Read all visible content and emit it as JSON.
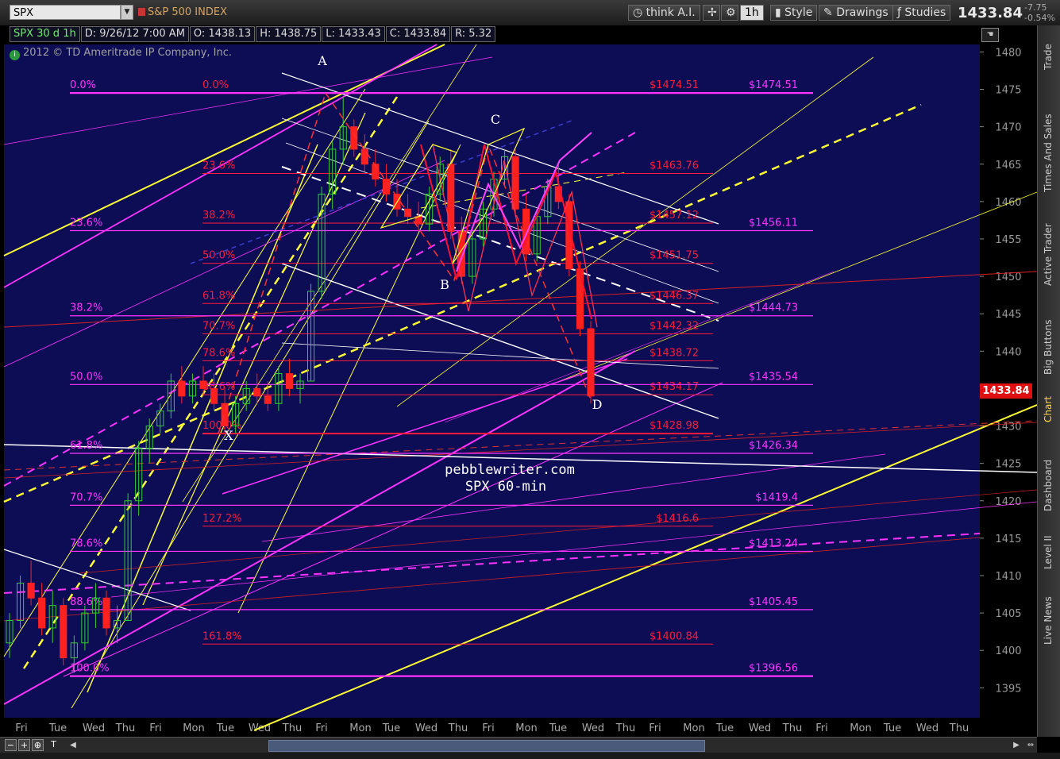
{
  "toolbar": {
    "symbol": "SPX",
    "symbol_name": "S&P 500 INDEX",
    "think_ai": "think A.I.",
    "timeframe": "1h",
    "style": "Style",
    "drawings": "Drawings",
    "studies": "Studies",
    "last_price": "1433.84",
    "change": "-7.75",
    "change_pct": "-0.54%"
  },
  "infobar": {
    "symbol_tf": "SPX 30 d 1h",
    "date": "D: 9/26/12 7:00 AM",
    "open": "O: 1438.13",
    "high": "H: 1438.75",
    "low": "L: 1433.43",
    "close": "C: 1433.84",
    "range": "R: 5.32"
  },
  "copyright": "2012 © TD Ameritrade IP Company, Inc.",
  "right_tabs": [
    "Trade",
    "Times And Sales",
    "Active Trader",
    "Big Buttons",
    "Chart",
    "Dashboard",
    "Level II",
    "Live News"
  ],
  "active_tab": "Chart",
  "price_flag": "1433.84",
  "colors": {
    "background": "#0d0d56",
    "candle_up": "#33cc33",
    "candle_down": "#ff2020",
    "fib_red": "#ff1a3a",
    "fib_magenta": "#ff33ff",
    "yellow": "#ffff33",
    "white": "#ffffff"
  },
  "chart_data": {
    "type": "candlestick",
    "title": "",
    "watermark": [
      "pebblewriter.com",
      "SPX 60-min"
    ],
    "ylim": [
      1391,
      1481
    ],
    "y_ticks": [
      1395,
      1400,
      1405,
      1410,
      1415,
      1420,
      1425,
      1430,
      1435,
      1440,
      1445,
      1450,
      1455,
      1460,
      1465,
      1470,
      1475,
      1480
    ],
    "x_ticks": [
      "Fri",
      "Tue",
      "Wed",
      "Thu",
      "Fri",
      "Mon",
      "Tue",
      "Wed",
      "Thu",
      "Fri",
      "Mon",
      "Tue",
      "Wed",
      "Thu",
      "Fri",
      "Mon",
      "Tue",
      "Wed",
      "Thu",
      "Fri",
      "Mon",
      "Tue",
      "Wed",
      "Thu"
    ],
    "pattern_points": [
      {
        "label": "X",
        "price": 1429.0
      },
      {
        "label": "A",
        "price": 1474.5
      },
      {
        "label": "B",
        "price": 1449.5
      },
      {
        "label": "C",
        "price": 1467.5
      },
      {
        "label": "D",
        "price": 1433.8
      }
    ],
    "fib_levels_red": [
      {
        "pct": "0.0%",
        "price": 1474.51
      },
      {
        "pct": "23.6%",
        "price": 1463.76
      },
      {
        "pct": "38.2%",
        "price": 1457.12
      },
      {
        "pct": "50.0%",
        "price": 1451.75
      },
      {
        "pct": "61.8%",
        "price": 1446.37
      },
      {
        "pct": "70.7%",
        "price": 1442.32
      },
      {
        "pct": "78.6%",
        "price": 1438.72
      },
      {
        "pct": "88.6%",
        "price": 1434.17
      },
      {
        "pct": "100.0%",
        "price": 1428.98
      },
      {
        "pct": "127.2%",
        "price": 1416.6
      },
      {
        "pct": "161.8%",
        "price": 1400.84
      }
    ],
    "fib_levels_magenta": [
      {
        "pct": "0.0%",
        "price": 1474.51
      },
      {
        "pct": "23.6%",
        "price": 1456.11
      },
      {
        "pct": "38.2%",
        "price": 1444.73
      },
      {
        "pct": "50.0%",
        "price": 1435.54
      },
      {
        "pct": "61.8%",
        "price": 1426.34
      },
      {
        "pct": "70.7%",
        "price": 1419.4
      },
      {
        "pct": "78.6%",
        "price": 1413.24
      },
      {
        "pct": "88.6%",
        "price": 1405.45
      },
      {
        "pct": "100.0%",
        "price": 1396.56
      }
    ],
    "price_labels_red": [
      "$1474.51",
      "$1463.76",
      "$1457.12",
      "$1451.75",
      "$1446.37",
      "$1442.32",
      "$1438.72",
      "$1434.17",
      "$1428.98",
      "$1416.6",
      "$1400.84"
    ],
    "price_labels_magenta": [
      "$1474.51",
      "$1456.11",
      "$1444.73",
      "$1435.54",
      "$1426.34",
      "$1419.4",
      "$1413.24",
      "$1405.45",
      "$1396.56"
    ],
    "candles": [
      {
        "o": 1401,
        "h": 1405,
        "l": 1399,
        "c": 1404
      },
      {
        "o": 1404,
        "h": 1410,
        "l": 1403,
        "c": 1409
      },
      {
        "o": 1409,
        "h": 1412,
        "l": 1406,
        "c": 1407
      },
      {
        "o": 1407,
        "h": 1409,
        "l": 1402,
        "c": 1403
      },
      {
        "o": 1403,
        "h": 1408,
        "l": 1401,
        "c": 1406
      },
      {
        "o": 1406,
        "h": 1407,
        "l": 1398,
        "c": 1399
      },
      {
        "o": 1399,
        "h": 1402,
        "l": 1397,
        "c": 1401
      },
      {
        "o": 1401,
        "h": 1406,
        "l": 1400,
        "c": 1405
      },
      {
        "o": 1405,
        "h": 1409,
        "l": 1403,
        "c": 1407
      },
      {
        "o": 1407,
        "h": 1408,
        "l": 1402,
        "c": 1403
      },
      {
        "o": 1403,
        "h": 1406,
        "l": 1401,
        "c": 1404
      },
      {
        "o": 1404,
        "h": 1421,
        "l": 1404,
        "c": 1420
      },
      {
        "o": 1420,
        "h": 1428,
        "l": 1418,
        "c": 1427
      },
      {
        "o": 1427,
        "h": 1431,
        "l": 1425,
        "c": 1430
      },
      {
        "o": 1430,
        "h": 1433,
        "l": 1429,
        "c": 1432
      },
      {
        "o": 1432,
        "h": 1437,
        "l": 1431,
        "c": 1436
      },
      {
        "o": 1436,
        "h": 1438,
        "l": 1433,
        "c": 1434
      },
      {
        "o": 1434,
        "h": 1437,
        "l": 1433,
        "c": 1436
      },
      {
        "o": 1436,
        "h": 1438,
        "l": 1434,
        "c": 1435
      },
      {
        "o": 1435,
        "h": 1437,
        "l": 1432,
        "c": 1433
      },
      {
        "o": 1433,
        "h": 1435,
        "l": 1429,
        "c": 1430
      },
      {
        "o": 1430,
        "h": 1434,
        "l": 1429,
        "c": 1433
      },
      {
        "o": 1433,
        "h": 1436,
        "l": 1432,
        "c": 1435
      },
      {
        "o": 1435,
        "h": 1437,
        "l": 1433,
        "c": 1434
      },
      {
        "o": 1434,
        "h": 1436,
        "l": 1432,
        "c": 1433
      },
      {
        "o": 1433,
        "h": 1438,
        "l": 1432,
        "c": 1437
      },
      {
        "o": 1437,
        "h": 1439,
        "l": 1434,
        "c": 1435
      },
      {
        "o": 1435,
        "h": 1437,
        "l": 1433,
        "c": 1436
      },
      {
        "o": 1436,
        "h": 1449,
        "l": 1436,
        "c": 1448
      },
      {
        "o": 1448,
        "h": 1462,
        "l": 1447,
        "c": 1461
      },
      {
        "o": 1461,
        "h": 1468,
        "l": 1459,
        "c": 1467
      },
      {
        "o": 1467,
        "h": 1474,
        "l": 1465,
        "c": 1470
      },
      {
        "o": 1470,
        "h": 1471,
        "l": 1466,
        "c": 1467
      },
      {
        "o": 1467,
        "h": 1469,
        "l": 1464,
        "c": 1465
      },
      {
        "o": 1465,
        "h": 1467,
        "l": 1462,
        "c": 1463
      },
      {
        "o": 1463,
        "h": 1465,
        "l": 1460,
        "c": 1461
      },
      {
        "o": 1461,
        "h": 1463,
        "l": 1458,
        "c": 1459
      },
      {
        "o": 1459,
        "h": 1461,
        "l": 1457,
        "c": 1458
      },
      {
        "o": 1458,
        "h": 1460,
        "l": 1456,
        "c": 1457
      },
      {
        "o": 1457,
        "h": 1462,
        "l": 1456,
        "c": 1461
      },
      {
        "o": 1461,
        "h": 1466,
        "l": 1460,
        "c": 1465
      },
      {
        "o": 1465,
        "h": 1467,
        "l": 1455,
        "c": 1456
      },
      {
        "o": 1456,
        "h": 1458,
        "l": 1449,
        "c": 1450
      },
      {
        "o": 1450,
        "h": 1456,
        "l": 1449,
        "c": 1455
      },
      {
        "o": 1455,
        "h": 1460,
        "l": 1454,
        "c": 1459
      },
      {
        "o": 1459,
        "h": 1464,
        "l": 1458,
        "c": 1463
      },
      {
        "o": 1463,
        "h": 1467,
        "l": 1462,
        "c": 1466
      },
      {
        "o": 1466,
        "h": 1467,
        "l": 1458,
        "c": 1459
      },
      {
        "o": 1459,
        "h": 1461,
        "l": 1452,
        "c": 1453
      },
      {
        "o": 1453,
        "h": 1459,
        "l": 1452,
        "c": 1458
      },
      {
        "o": 1458,
        "h": 1463,
        "l": 1457,
        "c": 1462
      },
      {
        "o": 1462,
        "h": 1465,
        "l": 1459,
        "c": 1460
      },
      {
        "o": 1460,
        "h": 1461,
        "l": 1450,
        "c": 1451
      },
      {
        "o": 1451,
        "h": 1452,
        "l": 1442,
        "c": 1443
      },
      {
        "o": 1443,
        "h": 1444,
        "l": 1433,
        "c": 1434
      }
    ]
  }
}
